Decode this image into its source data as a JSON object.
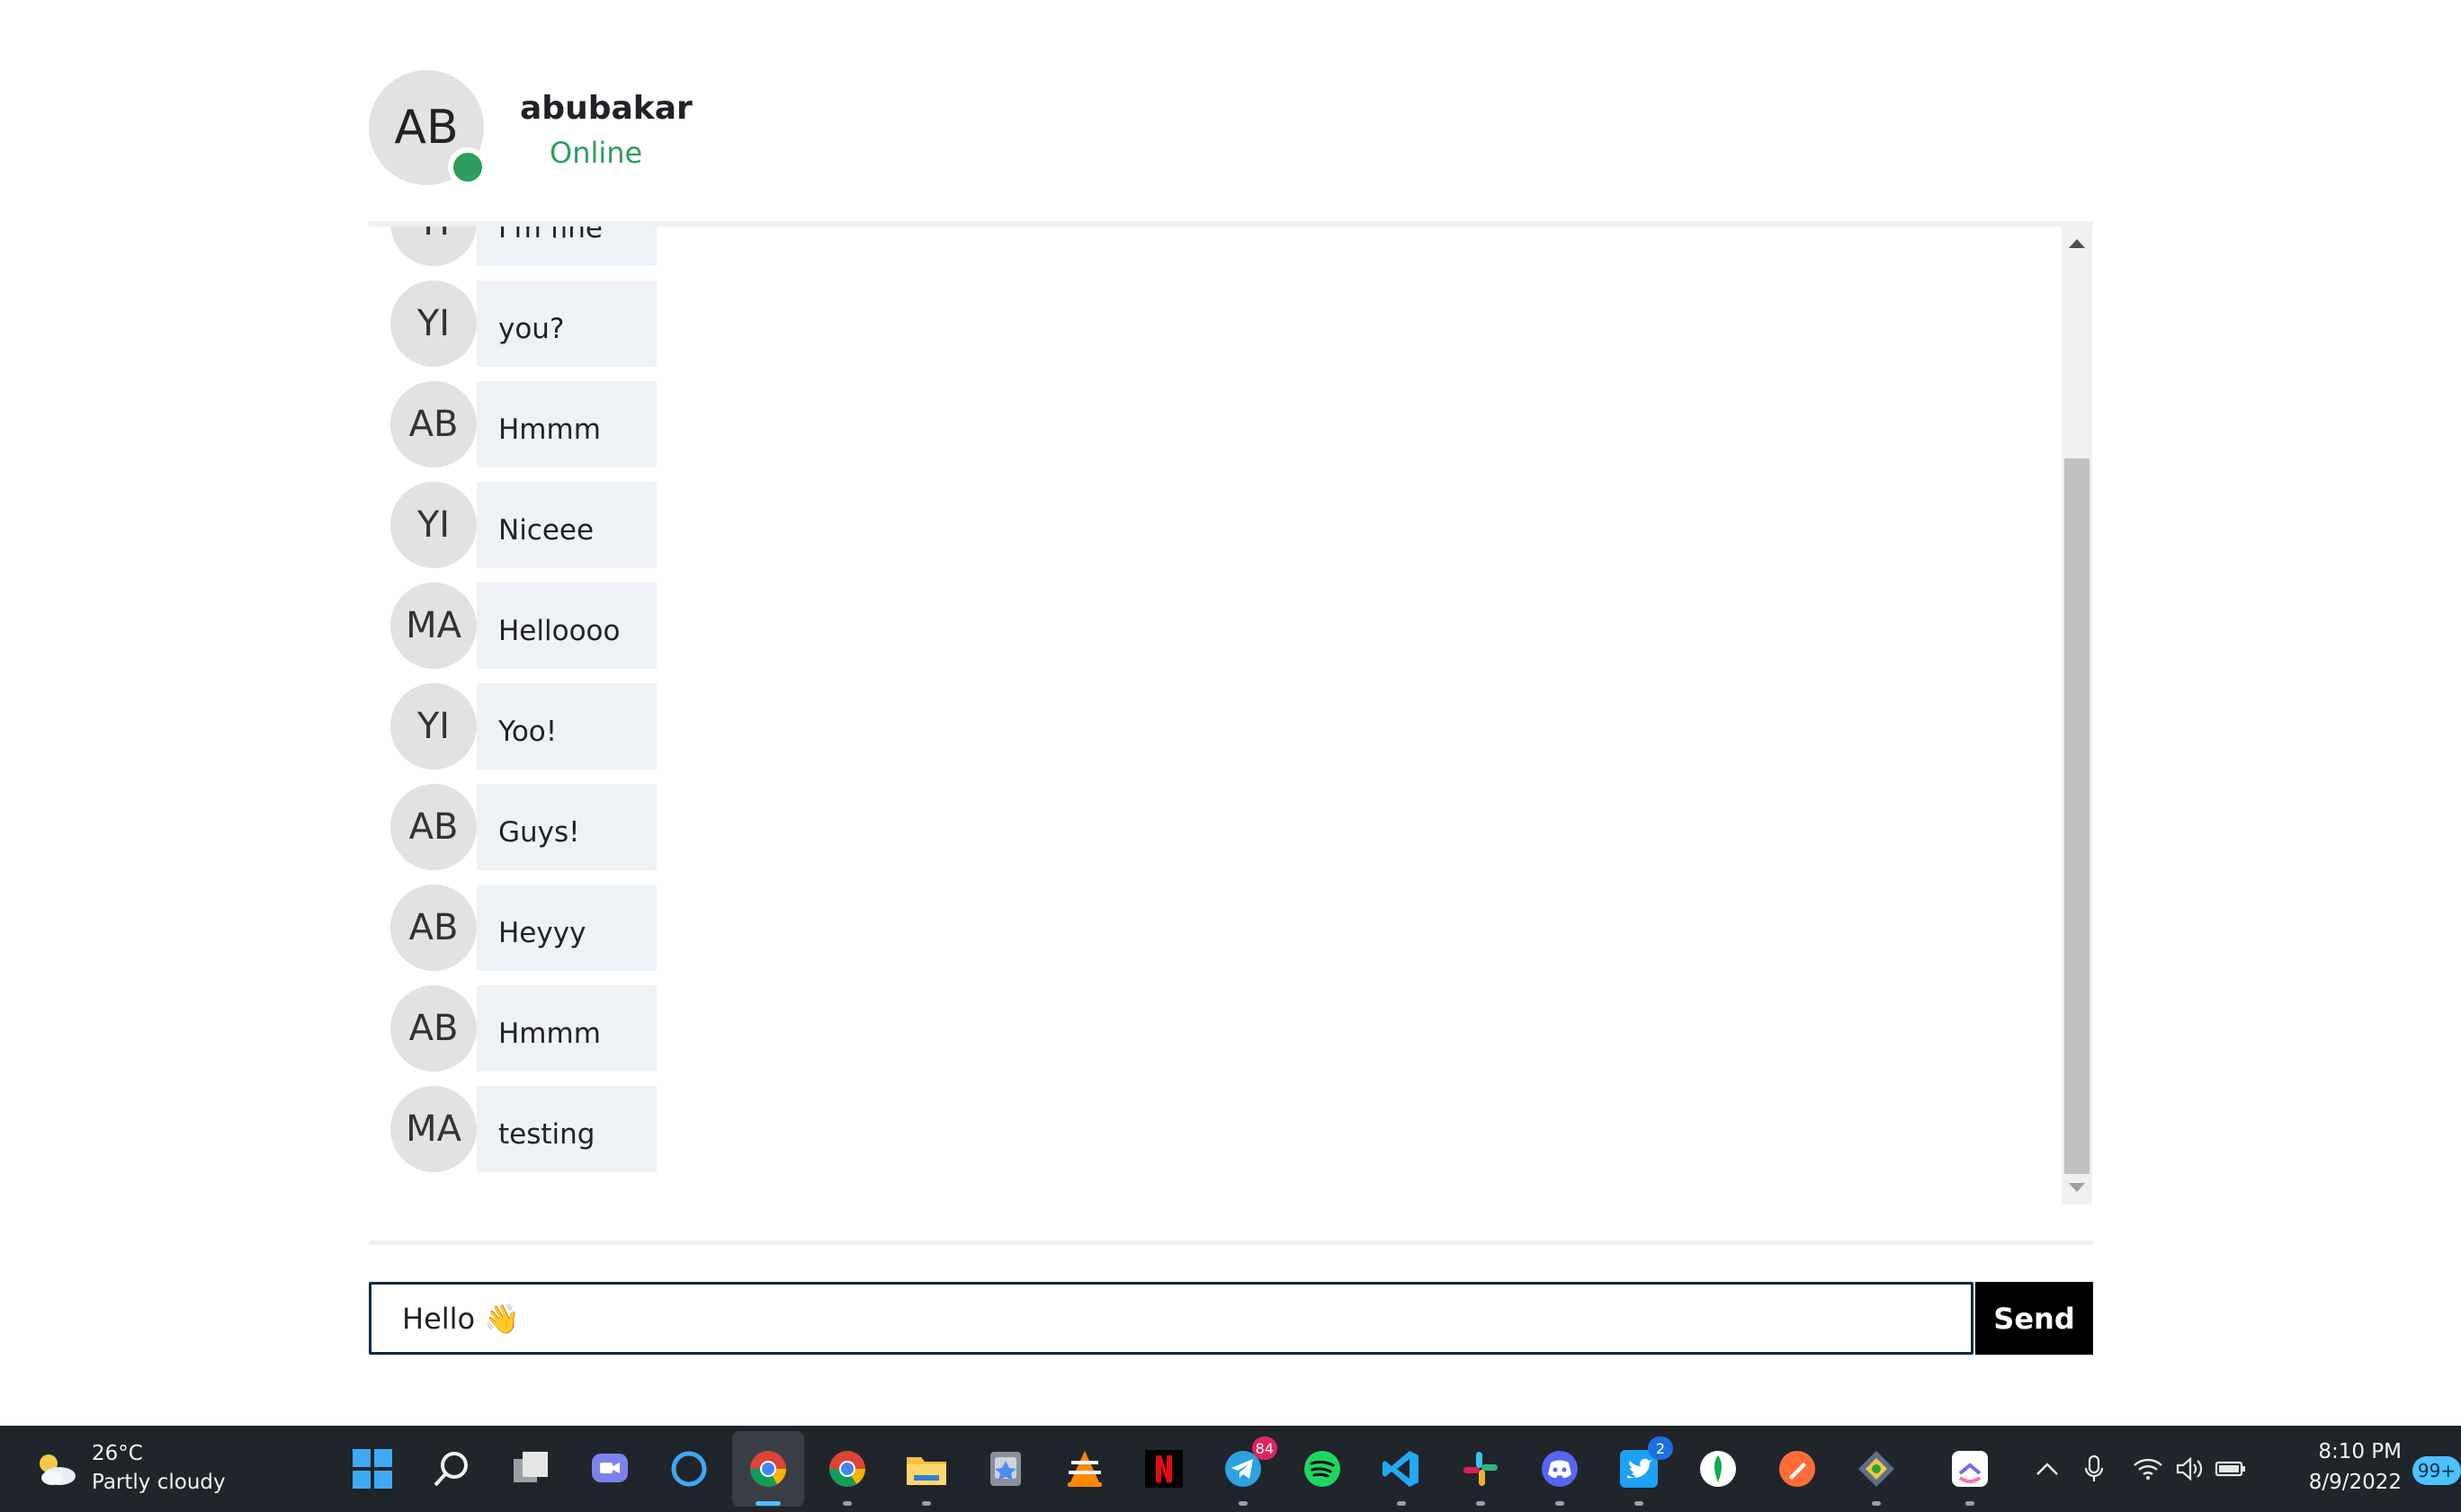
{
  "header": {
    "avatar_initials": "AB",
    "name": "abubakar",
    "status": "Online",
    "status_color": "#2e9d5d"
  },
  "messages": [
    {
      "initials": "YI",
      "text": "I'm fine"
    },
    {
      "initials": "YI",
      "text": "you?"
    },
    {
      "initials": "AB",
      "text": "Hmmm"
    },
    {
      "initials": "YI",
      "text": "Niceee"
    },
    {
      "initials": "MA",
      "text": "Helloooo"
    },
    {
      "initials": "YI",
      "text": "Yoo!"
    },
    {
      "initials": "AB",
      "text": "Guys!"
    },
    {
      "initials": "AB",
      "text": "Heyyy"
    },
    {
      "initials": "AB",
      "text": "Hmmm"
    },
    {
      "initials": "MA",
      "text": "testing"
    }
  ],
  "composer": {
    "input_value": "Hello 👋",
    "send_label": "Send"
  },
  "taskbar": {
    "weather_temp": "26°C",
    "weather_desc": "Partly cloudy",
    "apps": [
      {
        "name": "windows-start-icon"
      },
      {
        "name": "search-icon"
      },
      {
        "name": "task-view-icon"
      },
      {
        "name": "teams-chat-icon"
      },
      {
        "name": "cortana-icon"
      },
      {
        "name": "chrome-icon"
      },
      {
        "name": "chrome-profile-icon"
      },
      {
        "name": "file-explorer-icon"
      },
      {
        "name": "app-installer-icon"
      },
      {
        "name": "vlc-icon"
      },
      {
        "name": "netflix-icon"
      },
      {
        "name": "telegram-icon",
        "badge": "84"
      },
      {
        "name": "spotify-icon"
      },
      {
        "name": "vscode-icon"
      },
      {
        "name": "slack-icon"
      },
      {
        "name": "discord-icon"
      },
      {
        "name": "twitter-icon",
        "badge": "2"
      },
      {
        "name": "mongodb-compass-icon"
      },
      {
        "name": "postman-icon"
      },
      {
        "name": "gitkraken-icon"
      },
      {
        "name": "clickup-icon"
      }
    ],
    "time": "8:10 PM",
    "date": "8/9/2022",
    "notifications": "99+"
  }
}
